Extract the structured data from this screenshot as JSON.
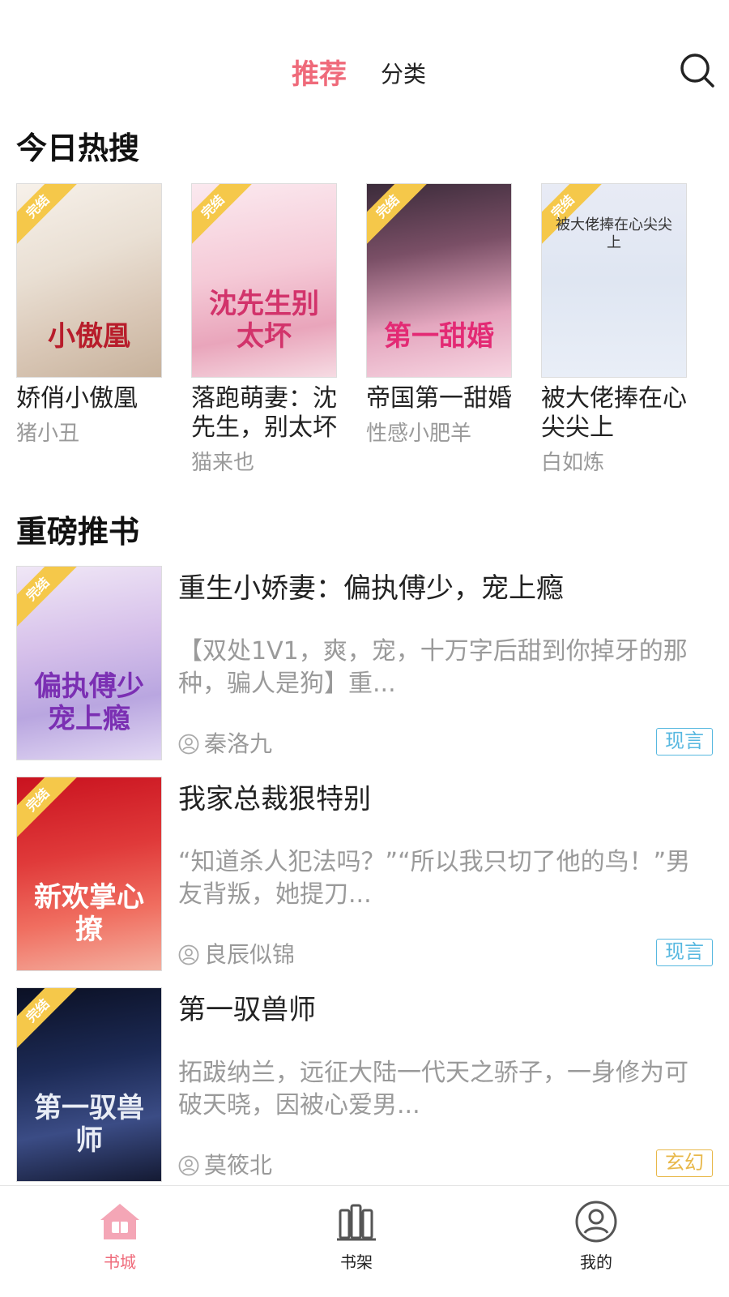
{
  "header": {
    "tab_recommend": "推荐",
    "tab_category": "分类",
    "search_icon": "search-icon",
    "accent": "#ef6a7a"
  },
  "hot": {
    "title": "今日热搜",
    "badge": "完结",
    "items": [
      {
        "title": "娇俏小傲凰",
        "author": "猪小丑",
        "cover_text": "小傲凰"
      },
      {
        "title": "落跑萌妻：沈先生，别太坏",
        "author": "猫来也",
        "cover_text": "沈先生别太坏"
      },
      {
        "title": "帝国第一甜婚",
        "author": "性感小肥羊",
        "cover_text": "第一甜婚"
      },
      {
        "title": "被大佬捧在心尖尖上",
        "author": "白如炼",
        "cover_text": "被大佬捧在心尖尖上"
      }
    ]
  },
  "featured": {
    "title": "重磅推书",
    "badge": "完结",
    "items": [
      {
        "title": "重生小娇妻：偏执傅少，宠上瘾",
        "desc": "【双处1V1，爽，宠，十万字后甜到你掉牙的那种，骗人是狗】重...",
        "author": "秦洛九",
        "genre": "现言",
        "genre_color": "#58b8e0",
        "cover_text": "偏执傅少宠上瘾"
      },
      {
        "title": "我家总裁狠特别",
        "desc": "“知道杀人犯法吗？”“所以我只切了他的鸟！”男友背叛，她提刀...",
        "author": "良辰似锦",
        "genre": "现言",
        "genre_color": "#58b8e0",
        "cover_text": "新欢掌心撩"
      },
      {
        "title": "第一驭兽师",
        "desc": "拓跋纳兰，远征大陆一代天之骄子，一身修为可破天晓，因被心爱男...",
        "author": "莫筱北",
        "genre": "玄幻",
        "genre_color": "#e8b84a",
        "cover_text": "第一驭兽师"
      }
    ]
  },
  "tabbar": {
    "items": [
      {
        "label": "书城",
        "icon": "home-icon",
        "active": true
      },
      {
        "label": "书架",
        "icon": "bookshelf-icon",
        "active": false
      },
      {
        "label": "我的",
        "icon": "profile-icon",
        "active": false
      }
    ]
  }
}
